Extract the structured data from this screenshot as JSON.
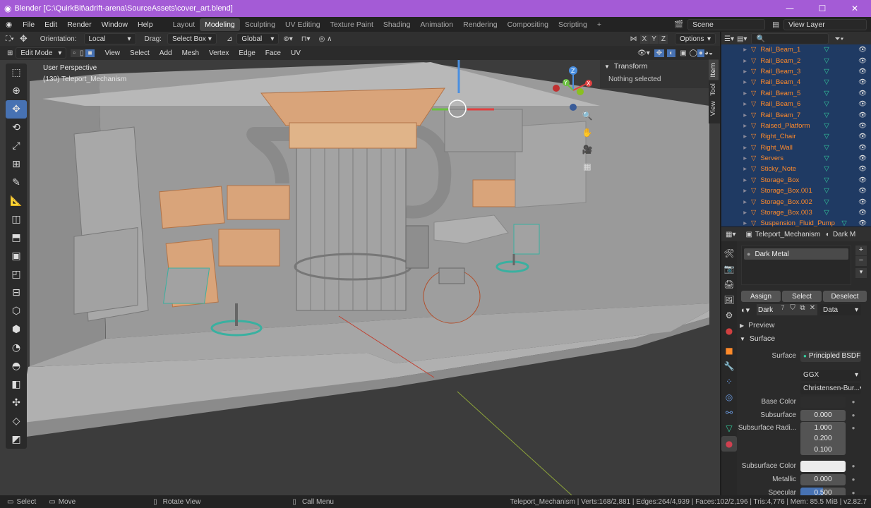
{
  "window": {
    "title": "Blender [C:\\QuirkBit\\adrift-arena\\SourceAssets\\cover_art.blend]",
    "min": "—",
    "max": "☐",
    "close": "✕"
  },
  "menu": [
    "File",
    "Edit",
    "Render",
    "Window",
    "Help"
  ],
  "workspaces": [
    "Layout",
    "Modeling",
    "Sculpting",
    "UV Editing",
    "Texture Paint",
    "Shading",
    "Animation",
    "Rendering",
    "Compositing",
    "Scripting"
  ],
  "workspace_add": "+",
  "scene": {
    "name": "Scene",
    "view_layer": "View Layer"
  },
  "header": {
    "orientation_label": "Orientation:",
    "orientation_value": "Local",
    "drag_label": "Drag:",
    "drag_value": "Select Box",
    "transform_orientation": "Global",
    "options": "Options",
    "axes": [
      "X",
      "Y",
      "Z"
    ]
  },
  "edit_header": {
    "mode": "Edit Mode",
    "menus": [
      "View",
      "Select",
      "Add",
      "Mesh",
      "Vertex",
      "Edge",
      "Face",
      "UV"
    ]
  },
  "viewport": {
    "perspective": "User Perspective",
    "object_info": "(130) Teleport_Mechanism",
    "sidebar_tabs": [
      "Item",
      "Tool",
      "View"
    ],
    "transform_title": "Transform",
    "transform_msg": "Nothing selected",
    "gizmo": {
      "x": "X",
      "y": "Y",
      "z": "Z"
    }
  },
  "outliner": {
    "items": [
      "Rail_Beam_1",
      "Rail_Beam_2",
      "Rail_Beam_3",
      "Rail_Beam_4",
      "Rail_Beam_5",
      "Rail_Beam_6",
      "Rail_Beam_7",
      "Raised_Platform",
      "Right_Chair",
      "Right_Wall",
      "Servers",
      "Sticky_Note",
      "Storage_Box",
      "Storage_Box.001",
      "Storage_Box.002",
      "Storage_Box.003",
      "Suspension_Fluid_Pump"
    ]
  },
  "properties": {
    "object_name": "Teleport_Mechanism",
    "data_name": "Dark M",
    "material_slot": "Dark Metal",
    "assign": "Assign",
    "select": "Select",
    "deselect": "Deselect",
    "material_name": "Dark",
    "user_count": "7",
    "link": "Data",
    "preview": "Preview",
    "surface_panel": "Surface",
    "fields": {
      "surface": {
        "label": "Surface",
        "value": "Principled BSDF"
      },
      "distribution": "GGX",
      "subsurface_method": "Christensen-Bur...",
      "base_color": {
        "label": "Base Color",
        "color": "#2d2d2d"
      },
      "subsurface": {
        "label": "Subsurface",
        "value": "0.000"
      },
      "subsurface_radius": {
        "label": "Subsurface Radi...",
        "values": [
          "1.000",
          "0.200",
          "0.100"
        ]
      },
      "subsurface_color": {
        "label": "Subsurface Color",
        "color": "#ececec"
      },
      "metallic": {
        "label": "Metallic",
        "value": "0.000"
      },
      "specular": {
        "label": "Specular",
        "value": "0.500"
      }
    }
  },
  "status": {
    "select": "Select",
    "move": "Move",
    "rotate": "Rotate View",
    "call_menu": "Call Menu",
    "stats": "Teleport_Mechanism | Verts:168/2,881 | Edges:264/4,939 | Faces:102/2,196 | Tris:4,776 | Mem: 85.5 MiB | v2.82.7"
  },
  "colors": {
    "accent": "#4772b3",
    "selection": "#ff8a2a",
    "title_bar": "#a45bd6",
    "outliner_bg": "#1f3a63"
  }
}
